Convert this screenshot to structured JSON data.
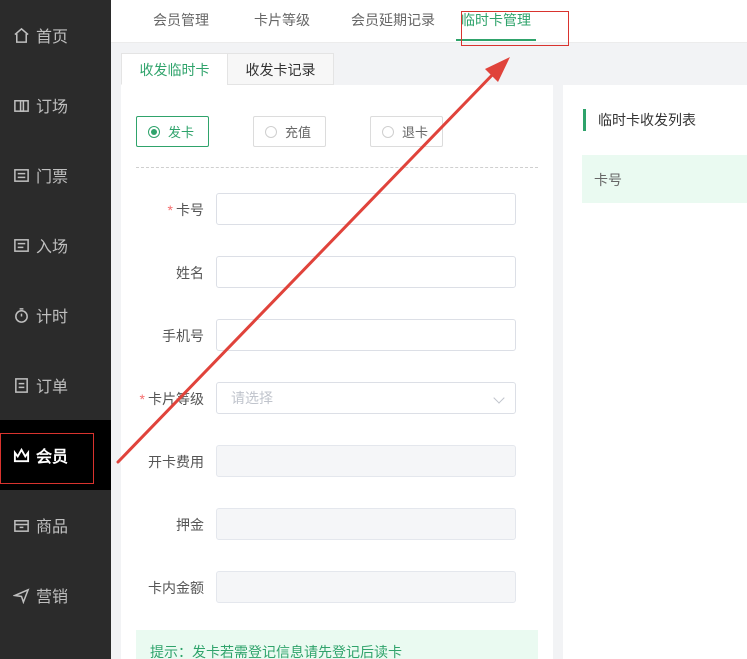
{
  "sidebar": {
    "items": [
      {
        "label": "首页",
        "icon": "home-icon"
      },
      {
        "label": "订场",
        "icon": "court-icon"
      },
      {
        "label": "门票",
        "icon": "ticket-icon"
      },
      {
        "label": "入场",
        "icon": "entry-icon"
      },
      {
        "label": "计时",
        "icon": "timer-icon"
      },
      {
        "label": "订单",
        "icon": "order-icon"
      },
      {
        "label": "会员",
        "icon": "crown-icon",
        "active": true
      },
      {
        "label": "商品",
        "icon": "goods-icon"
      },
      {
        "label": "营销",
        "icon": "marketing-icon"
      }
    ]
  },
  "top_tabs": [
    {
      "label": "会员管理"
    },
    {
      "label": "卡片等级"
    },
    {
      "label": "会员延期记录"
    },
    {
      "label": "临时卡管理",
      "active": true
    }
  ],
  "sub_tabs": [
    {
      "label": "收发临时卡",
      "active": true
    },
    {
      "label": "收发卡记录"
    }
  ],
  "radios": [
    {
      "label": "发卡",
      "checked": true
    },
    {
      "label": "充值"
    },
    {
      "label": "退卡"
    }
  ],
  "form": {
    "card_no": {
      "label": "卡号",
      "value": ""
    },
    "name": {
      "label": "姓名",
      "value": ""
    },
    "phone": {
      "label": "手机号",
      "value": ""
    },
    "card_level": {
      "label": "卡片等级",
      "placeholder": "请选择"
    },
    "open_fee": {
      "label": "开卡费用",
      "value": ""
    },
    "deposit": {
      "label": "押金",
      "value": ""
    },
    "balance": {
      "label": "卡内金额",
      "value": ""
    }
  },
  "tip": "提示：发卡若需登记信息请先登记后读卡",
  "right_panel": {
    "title": "临时卡收发列表",
    "column_header": "卡号"
  },
  "colors": {
    "accent": "#2fa36b",
    "sidebar_bg": "#2b2b2b",
    "annotation": "#d9332e"
  }
}
